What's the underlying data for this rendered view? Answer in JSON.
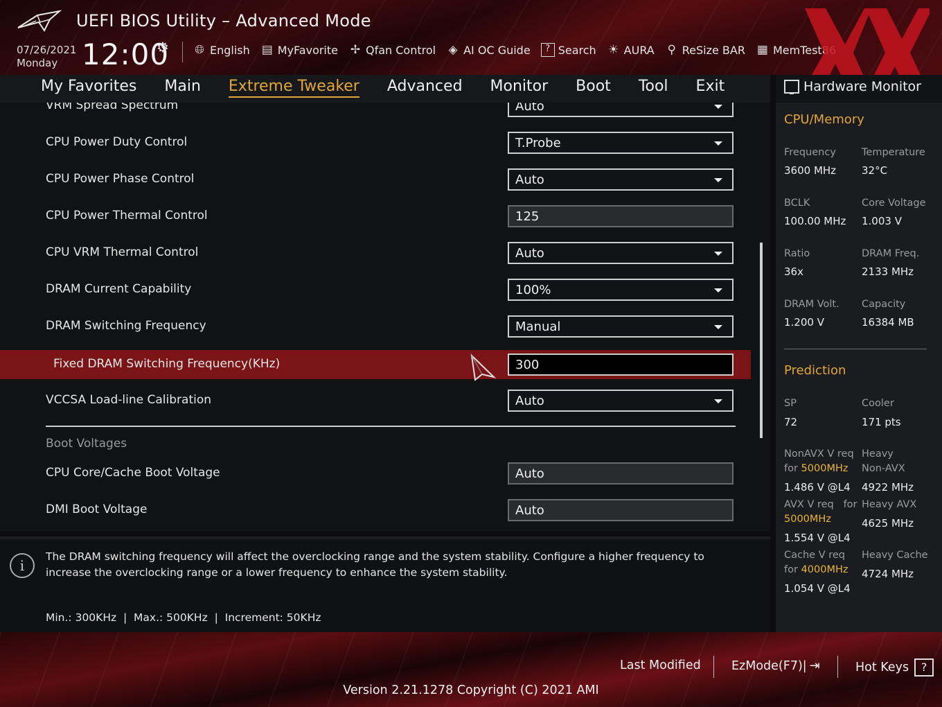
{
  "header": {
    "title": "UEFI BIOS Utility – Advanced Mode",
    "date": "07/26/2021",
    "day": "Monday",
    "time": "12:00",
    "toolbar": [
      {
        "icon": "globe-icon",
        "label": "English"
      },
      {
        "icon": "favorite-list-icon",
        "label": "MyFavorite"
      },
      {
        "icon": "fan-icon",
        "label": "Qfan Control"
      },
      {
        "icon": "ai-oc-icon",
        "label": "AI OC Guide"
      },
      {
        "icon": "search-question-icon",
        "label": "Search"
      },
      {
        "icon": "aura-light-icon",
        "label": "AURA"
      },
      {
        "icon": "resize-bar-icon",
        "label": "ReSize BAR"
      },
      {
        "icon": "memory-icon",
        "label": "MemTest86"
      }
    ]
  },
  "nav": {
    "tabs": [
      "My Favorites",
      "Main",
      "Extreme Tweaker",
      "Advanced",
      "Monitor",
      "Boot",
      "Tool",
      "Exit"
    ],
    "active": "Extreme Tweaker"
  },
  "settings": [
    {
      "label": "VRM Spread Spectrum",
      "value": "Auto",
      "type": "dropdown"
    },
    {
      "label": "CPU Power Duty Control",
      "value": "T.Probe",
      "type": "dropdown"
    },
    {
      "label": "CPU Power Phase Control",
      "value": "Auto",
      "type": "dropdown"
    },
    {
      "label": "CPU Power Thermal Control",
      "value": "125",
      "type": "input"
    },
    {
      "label": "CPU VRM Thermal Control",
      "value": "Auto",
      "type": "dropdown"
    },
    {
      "label": "DRAM Current Capability",
      "value": "100%",
      "type": "dropdown"
    },
    {
      "label": "DRAM Switching Frequency",
      "value": "Manual",
      "type": "dropdown"
    },
    {
      "label": "Fixed DRAM Switching Frequency(KHz)",
      "value": "300",
      "type": "input-active"
    },
    {
      "label": "VCCSA Load-line Calibration",
      "value": "Auto",
      "type": "dropdown"
    }
  ],
  "boot_section": {
    "title": "Boot Voltages",
    "items": [
      {
        "label": "CPU Core/Cache Boot Voltage",
        "value": "Auto"
      },
      {
        "label": "DMI Boot Voltage",
        "value": "Auto"
      }
    ]
  },
  "help": {
    "text": "The DRAM switching frequency will affect the overclocking range and the system stability. Configure a higher frequency to increase the overclocking range or a lower frequency to enhance the system stability.",
    "range": "Min.: 300KHz  |  Max.: 500KHz  |  Increment: 50KHz"
  },
  "hw_monitor": {
    "title": "Hardware Monitor",
    "cpu_memory": {
      "section": "CPU/Memory",
      "frequency_label": "Frequency",
      "frequency": "3600 MHz",
      "temperature_label": "Temperature",
      "temperature": "32°C",
      "bclk_label": "BCLK",
      "bclk": "100.00 MHz",
      "core_voltage_label": "Core Voltage",
      "core_voltage": "1.003 V",
      "ratio_label": "Ratio",
      "ratio": "36x",
      "dram_freq_label": "DRAM Freq.",
      "dram_freq": "2133 MHz",
      "dram_volt_label": "DRAM Volt.",
      "dram_volt": "1.200 V",
      "capacity_label": "Capacity",
      "capacity": "16384 MB"
    },
    "prediction": {
      "section": "Prediction",
      "sp_label": "SP",
      "sp": "72",
      "cooler_label": "Cooler",
      "cooler": "171 pts",
      "nonavx_label": "NonAVX V req",
      "nonavx_for": "for",
      "nonavx_freq": "5000MHz",
      "nonavx_value": "1.486 V @L4",
      "heavy_nonavx_label1": "Heavy",
      "heavy_nonavx_label2": "Non-AVX",
      "heavy_nonavx_value": "4922 MHz",
      "avx_label": "AVX V req",
      "avx_for": "for",
      "avx_freq": "5000MHz",
      "avx_value": "1.554 V @L4",
      "heavy_avx_label": "Heavy AVX",
      "heavy_avx_value": "4625 MHz",
      "cache_label": "Cache V req",
      "cache_for": "for",
      "cache_freq": "4000MHz",
      "cache_value": "1.054 V @L4",
      "heavy_cache_label": "Heavy Cache",
      "heavy_cache_value": "4724 MHz"
    }
  },
  "footer": {
    "last_modified": "Last Modified",
    "ezmode": "EzMode(F7)|",
    "hotkeys": "Hot Keys",
    "hotkeys_key": "?",
    "version": "Version 2.21.1278 Copyright (C) 2021 AMI"
  },
  "colors": {
    "accent": "#e0a63a",
    "highlight_row": "#7a1416",
    "brand_red": "#c4141e"
  }
}
